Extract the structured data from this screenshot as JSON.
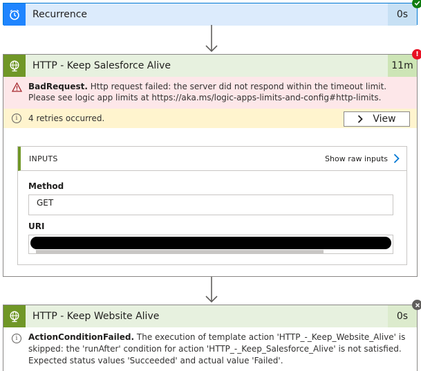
{
  "steps": {
    "recurrence": {
      "title": "Recurrence",
      "duration": "0s",
      "status": "succeeded"
    },
    "salesforce": {
      "title": "HTTP - Keep Salesforce Alive",
      "duration": "11m",
      "status": "failed",
      "error": {
        "code": "BadRequest.",
        "message": "Http request failed: the server did not respond within the timeout limit. Please see logic app limits at https://aka.ms/logic-apps-limits-and-config#http-limits."
      },
      "retries": {
        "text": "4 retries occurred.",
        "view_label": "View"
      },
      "inputs": {
        "header": "INPUTS",
        "raw_link": "Show raw inputs",
        "method_label": "Method",
        "method_value": "GET",
        "uri_label": "URI"
      }
    },
    "website": {
      "title": "HTTP - Keep Website Alive",
      "duration": "0s",
      "status": "skipped",
      "condition": {
        "code": "ActionConditionFailed.",
        "message": "The execution of template action 'HTTP_-_Keep_Website_Alive' is skipped: the 'runAfter' condition for action 'HTTP_-_Keep_Salesforce_Alive' is not satisfied. Expected status values 'Succeeded' and actual value 'Failed'."
      }
    }
  },
  "colors": {
    "success": "#107c10",
    "error": "#e81123",
    "skipped": "#605e5c",
    "accent": "#0078d4",
    "http_green": "#709727"
  },
  "icons": {
    "recurrence": "alarm-clock-icon",
    "http": "globe-icon",
    "warning": "warning-icon",
    "info": "info-icon"
  }
}
